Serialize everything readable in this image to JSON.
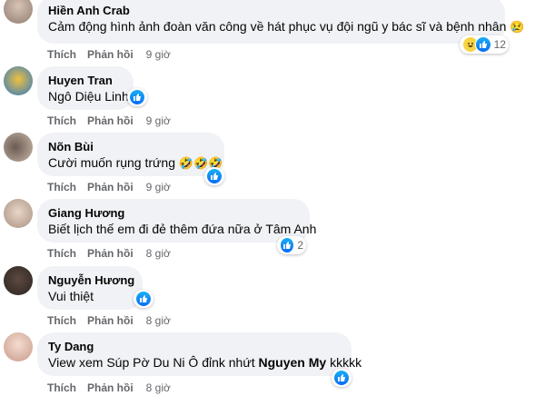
{
  "actions": {
    "like": "Thích",
    "reply": "Phản hồi"
  },
  "comments": [
    {
      "author": "Hiền Anh Crab",
      "text": "Cảm động hình ảnh đoàn văn công về hát phục vụ đội ngũ y bác sĩ và bệnh nhân",
      "time": "9 giờ",
      "reaction_count": "12"
    },
    {
      "author": "Huyen Tran",
      "text": "Ngô Diệu Linh",
      "time": "9 giờ"
    },
    {
      "author": "Nõn Bùi",
      "text": "Cười muốn rụng trứng",
      "time": "9 giờ"
    },
    {
      "author": "Giang Hương",
      "text": "Biết lịch thế em đi đẻ thêm đứa nữa ở Tâm Anh",
      "time": "8 giờ",
      "reaction_count": "2"
    },
    {
      "author": "Nguyễn Hương",
      "text": "Vui thiệt",
      "time": "8 giờ"
    },
    {
      "author": "Ty Dang",
      "text_before": "View xem Súp Pờ Du Ni Ô đỉnk nhứt",
      "mention": "Nguyen My",
      "text_after": "kkkkk",
      "time": "8 giờ"
    }
  ],
  "icons": {
    "like": "like-icon",
    "haha": "haha-icon",
    "cry": "crying-face-emoji"
  }
}
